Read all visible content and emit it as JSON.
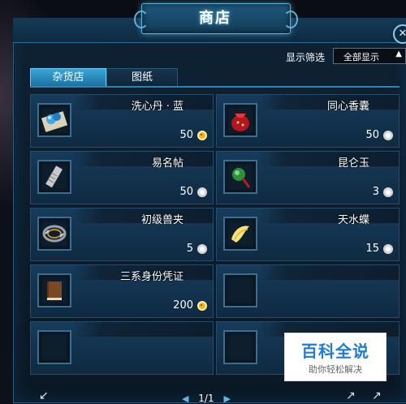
{
  "window": {
    "title": "商店",
    "close_icon": "close-icon"
  },
  "filter": {
    "label": "显示筛选",
    "selected": "全部显示"
  },
  "tabs": [
    {
      "label": "杂货店",
      "active": true
    },
    {
      "label": "图纸",
      "active": false
    }
  ],
  "items": [
    {
      "name": "洗心丹 · 蓝",
      "price": "50",
      "currency": "gold",
      "icon": "blue-pill-icon"
    },
    {
      "name": "同心香囊",
      "price": "50",
      "currency": "silver",
      "icon": "red-pouch-icon"
    },
    {
      "name": "易名帖",
      "price": "50",
      "currency": "silver",
      "icon": "scroll-tag-icon"
    },
    {
      "name": "昆仑玉",
      "price": "3",
      "currency": "silver",
      "icon": "jade-pendant-icon"
    },
    {
      "name": "初级兽夹",
      "price": "5",
      "currency": "silver",
      "icon": "beast-trap-icon"
    },
    {
      "name": "天水蝶",
      "price": "15",
      "currency": "silver",
      "icon": "butterfly-icon"
    },
    {
      "name": "三系身份凭证",
      "price": "200",
      "currency": "gold",
      "icon": "book-icon"
    }
  ],
  "pager": {
    "current": "1/1"
  },
  "watermark": {
    "main": "百科全说",
    "sub": "助你轻松解决"
  },
  "colors": {
    "accent": "#2c83b6",
    "gold": "#f2b61c",
    "panel": "#0f2a42"
  }
}
